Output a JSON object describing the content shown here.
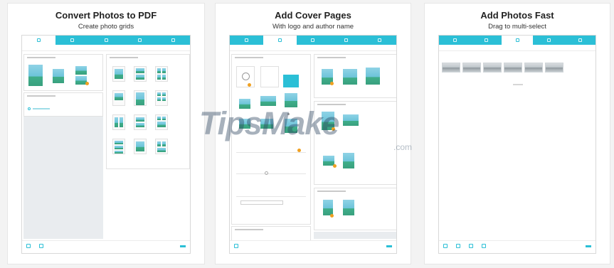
{
  "panels": [
    {
      "title": "Convert Photos to PDF",
      "subtitle": "Create photo grids"
    },
    {
      "title": "Add Cover Pages",
      "subtitle": "With logo and author name"
    },
    {
      "title": "Add Photos Fast",
      "subtitle": "Drag to multi-select"
    }
  ],
  "watermark": {
    "brand": "TipsMake",
    "suffix": ".com"
  },
  "colors": {
    "accent": "#2bbfd6",
    "badge": "#f0a020",
    "background": "#f3f3f3"
  }
}
